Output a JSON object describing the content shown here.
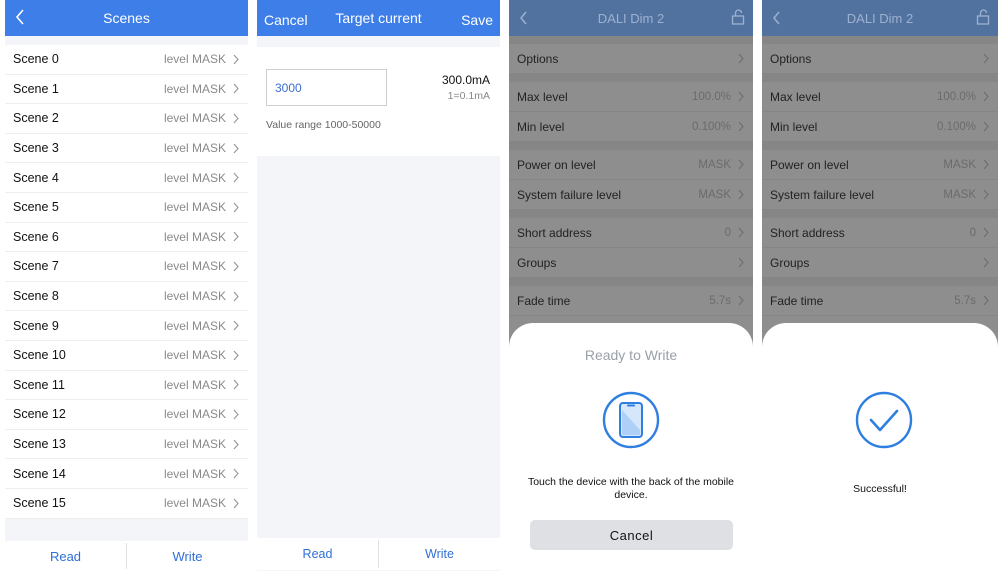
{
  "scenes_panel": {
    "title": "Scenes",
    "scenes": [
      {
        "name": "Scene 0",
        "value": "level MASK"
      },
      {
        "name": "Scene 1",
        "value": "level MASK"
      },
      {
        "name": "Scene 2",
        "value": "level MASK"
      },
      {
        "name": "Scene 3",
        "value": "level MASK"
      },
      {
        "name": "Scene 4",
        "value": "level MASK"
      },
      {
        "name": "Scene 5",
        "value": "level MASK"
      },
      {
        "name": "Scene 6",
        "value": "level MASK"
      },
      {
        "name": "Scene 7",
        "value": "level MASK"
      },
      {
        "name": "Scene 8",
        "value": "level MASK"
      },
      {
        "name": "Scene 9",
        "value": "level MASK"
      },
      {
        "name": "Scene 10",
        "value": "level MASK"
      },
      {
        "name": "Scene 11",
        "value": "level MASK"
      },
      {
        "name": "Scene 12",
        "value": "level MASK"
      },
      {
        "name": "Scene 13",
        "value": "level MASK"
      },
      {
        "name": "Scene 14",
        "value": "level MASK"
      },
      {
        "name": "Scene 15",
        "value": "level MASK"
      }
    ],
    "footer": {
      "read": "Read",
      "write": "Write"
    }
  },
  "target_panel": {
    "cancel": "Cancel",
    "title": "Target current",
    "save": "Save",
    "input_value": "3000",
    "display_value": "300.0mA",
    "unit_note": "1=0.1mA",
    "range_text": "Value range 1000-50000",
    "footer": {
      "read": "Read",
      "write": "Write"
    }
  },
  "device_panel": {
    "title": "DALI Dim 2",
    "groups": [
      [
        {
          "label": "Options",
          "value": ""
        }
      ],
      [
        {
          "label": "Max level",
          "value": "100.0%"
        },
        {
          "label": "Min level",
          "value": "0.100%"
        }
      ],
      [
        {
          "label": "Power on level",
          "value": "MASK"
        },
        {
          "label": "System failure level",
          "value": "MASK"
        }
      ],
      [
        {
          "label": "Short address",
          "value": "0"
        },
        {
          "label": "Groups",
          "value": ""
        }
      ],
      [
        {
          "label": "Fade time",
          "value": "5.7s"
        }
      ]
    ]
  },
  "write_sheet": {
    "title": "Ready to Write",
    "message": "Touch the device with the back of the mobile device.",
    "cancel": "Cancel"
  },
  "success_sheet": {
    "message": "Successful!"
  },
  "colors": {
    "header_blue": "#3d7ee8",
    "accent_blue": "#2f6fd8",
    "dim_header": "#51729f",
    "dim_body": "#8e8e8e"
  }
}
